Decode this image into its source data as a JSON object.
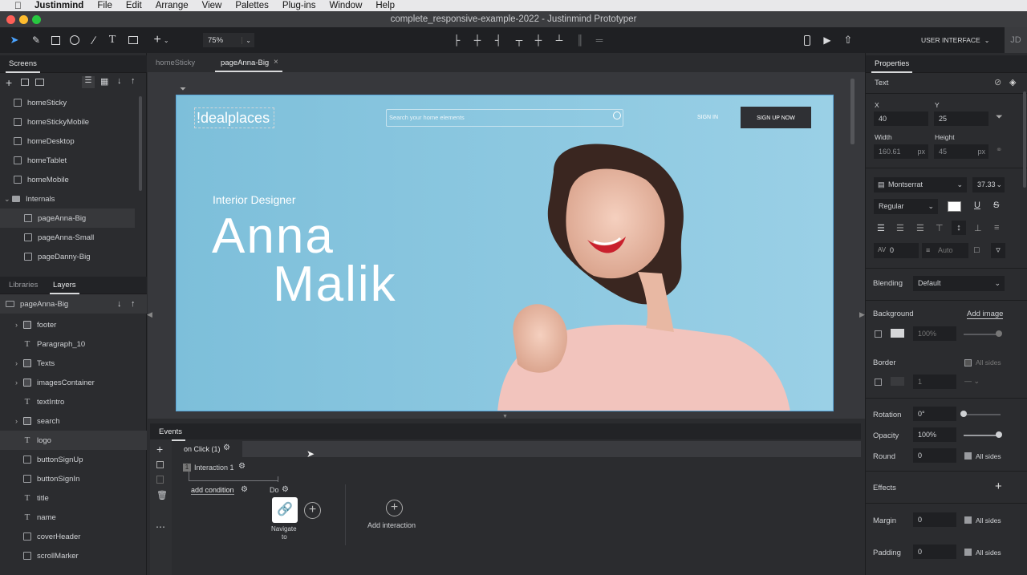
{
  "menubar": {
    "app": "Justinmind",
    "items": [
      "File",
      "Edit",
      "Arrange",
      "View",
      "Palettes",
      "Plug-ins",
      "Window",
      "Help"
    ]
  },
  "window": {
    "title": "complete_responsive-example-2022 - Justinmind Prototyper"
  },
  "toolbar": {
    "zoom": "75%",
    "ui_mode": "USER INTERFACE",
    "user_initials": "JD"
  },
  "screens_panel": {
    "tab": "Screens",
    "items": [
      "homeSticky",
      "homeStickyMobile",
      "homeDesktop",
      "homeTablet",
      "homeMobile"
    ],
    "folder": "Internals",
    "folder_items": [
      "pageAnna-Big",
      "pageAnna-Small",
      "pageDanny-Big"
    ]
  },
  "layers_panel": {
    "tabs": [
      "Libraries",
      "Layers"
    ],
    "root": "pageAnna-Big",
    "items": [
      "footer",
      "Paragraph_10",
      "Texts",
      "imagesContainer",
      "textIntro",
      "search",
      "logo",
      "buttonSignUp",
      "buttonSignIn",
      "title",
      "name",
      "coverHeader",
      "scrollMarker"
    ]
  },
  "doc_tabs": [
    "homeSticky",
    "pageAnna-Big"
  ],
  "canvas": {
    "logo": "!dealplaces",
    "search_placeholder": "Search your home elements",
    "sign_in": "SIGN IN",
    "sign_up": "SIGN UP NOW",
    "role": "Interior Designer",
    "first_name": "Anna",
    "last_name": "Malik"
  },
  "events": {
    "tab": "Events",
    "event": "on Click (1)",
    "interaction": "Interaction 1",
    "interaction_num": "1",
    "add_condition": "add condition",
    "do": "Do",
    "action_line1": "Navigate",
    "action_line2": "to",
    "add_interaction": "Add interaction"
  },
  "properties": {
    "tab": "Properties",
    "section": "Text",
    "x_label": "X",
    "x": "40",
    "y_label": "Y",
    "y": "25",
    "width_label": "Width",
    "width": "160.61",
    "width_unit": "px",
    "height_label": "Height",
    "height": "45",
    "height_unit": "px",
    "font": "Montserrat",
    "font_size": "37.33",
    "weight": "Regular",
    "letter_spacing": "0",
    "line_height": "Auto",
    "blending_label": "Blending",
    "blending": "Default",
    "background_label": "Background",
    "add_image": "Add image",
    "bg_opacity": "100%",
    "border_label": "Border",
    "border_width": "1",
    "all_sides": "All sides",
    "rotation_label": "Rotation",
    "rotation": "0°",
    "opacity_label": "Opacity",
    "opacity": "100%",
    "round_label": "Round",
    "round": "0",
    "effects_label": "Effects",
    "margin_label": "Margin",
    "margin": "0",
    "padding_label": "Padding",
    "padding": "0"
  },
  "colors": {
    "accent": "#5aa5d8",
    "canvas_bg": "#84c3dd",
    "signup_btn": "#2f3034"
  }
}
